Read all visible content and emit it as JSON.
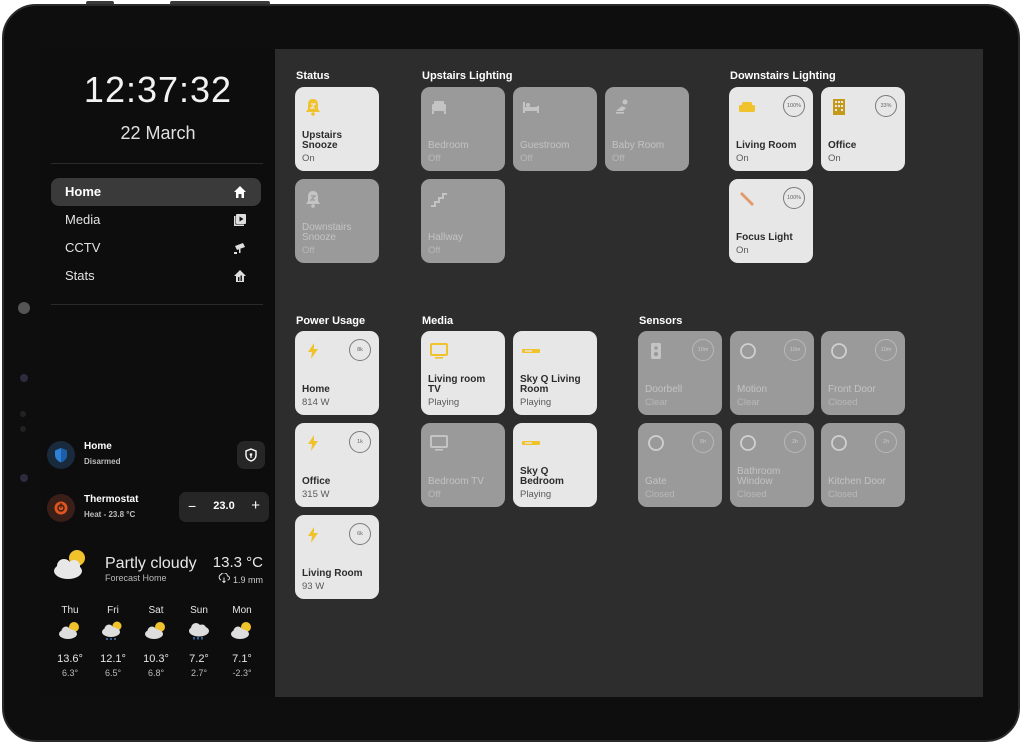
{
  "colors": {
    "accent_yellow": "#f0c22b",
    "tile_on": "#e7e7e7",
    "tile_off": "#9a9a9a",
    "screen_bg": "#2d2d2d",
    "sidebar_bg": "#0d0d0d",
    "alarm_blue": "#1c5fa8",
    "thermo_orange": "#e2541e"
  },
  "sidebar": {
    "time": "12:37:32",
    "date": "22 March",
    "nav": [
      {
        "label": "Home",
        "icon": "home-icon",
        "active": true
      },
      {
        "label": "Media",
        "icon": "media-play-icon"
      },
      {
        "label": "CCTV",
        "icon": "cctv-camera-icon"
      },
      {
        "label": "Stats",
        "icon": "stats-home-icon"
      }
    ],
    "alarm": {
      "title": "Home",
      "status": "Disarmed",
      "icon": "shield-icon"
    },
    "thermostat": {
      "title": "Thermostat",
      "status": "Heat - 23.8 °C",
      "setpoint": "23.0",
      "minus": "−",
      "plus": "+",
      "icon": "thermostat-icon"
    },
    "weather": {
      "condition": "Partly cloudy",
      "source": "Forecast Home",
      "temp": "13.3 °C",
      "precip": "1.9 mm",
      "forecast": [
        {
          "day": "Thu",
          "high": "13.6°",
          "low": "6.3°",
          "icon": "partly-cloudy-icon"
        },
        {
          "day": "Fri",
          "high": "12.1°",
          "low": "6.5°",
          "icon": "rain-icon"
        },
        {
          "day": "Sat",
          "high": "10.3°",
          "low": "6.8°",
          "icon": "partly-cloudy-icon"
        },
        {
          "day": "Sun",
          "high": "7.2°",
          "low": "2.7°",
          "icon": "rain-icon"
        },
        {
          "day": "Mon",
          "high": "7.1°",
          "low": "-2.3°",
          "icon": "partly-cloudy-icon"
        }
      ]
    }
  },
  "sections": {
    "status": {
      "title": "Status",
      "tiles": [
        {
          "name": "Upstairs Snooze",
          "state": "On",
          "on": true,
          "icon": "snooze-bell-icon"
        },
        {
          "name": "Downstairs Snooze",
          "state": "Off",
          "on": false,
          "icon": "snooze-bell-icon"
        }
      ]
    },
    "upstairs": {
      "title": "Upstairs Lighting",
      "tiles": [
        {
          "name": "Bedroom",
          "state": "Off",
          "on": false,
          "icon": "bed-icon"
        },
        {
          "name": "Guestroom",
          "state": "Off",
          "on": false,
          "icon": "bed-icon"
        },
        {
          "name": "Baby Room",
          "state": "Off",
          "on": false,
          "icon": "baby-icon"
        },
        {
          "name": "Hallway",
          "state": "Off",
          "on": false,
          "icon": "stairs-icon"
        }
      ]
    },
    "downstairs": {
      "title": "Downstairs Lighting",
      "tiles": [
        {
          "name": "Living Room",
          "state": "On",
          "on": true,
          "icon": "sofa-icon",
          "ring": "100%"
        },
        {
          "name": "Office",
          "state": "On",
          "on": true,
          "icon": "building-icon",
          "ring": "33%"
        },
        {
          "name": "Focus Light",
          "state": "On",
          "on": true,
          "icon": "light-tube-icon",
          "ring": "100%"
        }
      ]
    },
    "power": {
      "title": "Power Usage",
      "tiles": [
        {
          "name": "Home",
          "state": "814 W",
          "on": true,
          "icon": "bolt-icon",
          "ring": "8k"
        },
        {
          "name": "Office",
          "state": "315 W",
          "on": true,
          "icon": "bolt-icon",
          "ring": "1k"
        },
        {
          "name": "Living Room",
          "state": "93 W",
          "on": true,
          "icon": "bolt-icon",
          "ring": "6k"
        }
      ]
    },
    "media": {
      "title": "Media",
      "tiles": [
        {
          "name": "Living room TV",
          "state": "Playing",
          "on": true,
          "icon": "tv-icon"
        },
        {
          "name": "Sky Q Living Room",
          "state": "Playing",
          "on": true,
          "icon": "set-top-box-icon"
        },
        {
          "name": "Bedroom TV",
          "state": "Off",
          "on": false,
          "icon": "tv-icon"
        },
        {
          "name": "Sky Q Bedroom",
          "state": "Playing",
          "on": true,
          "icon": "set-top-box-icon"
        }
      ]
    },
    "sensors": {
      "title": "Sensors",
      "tiles": [
        {
          "name": "Doorbell",
          "state": "Clear",
          "on": false,
          "icon": "doorbell-icon",
          "ring": "10m"
        },
        {
          "name": "Motion",
          "state": "Clear",
          "on": false,
          "icon": "circle-icon",
          "ring": "10m"
        },
        {
          "name": "Front Door",
          "state": "Closed",
          "on": false,
          "icon": "circle-icon",
          "ring": "10m"
        },
        {
          "name": "Gate",
          "state": "Closed",
          "on": false,
          "icon": "circle-icon",
          "ring": "5h"
        },
        {
          "name": "Bathroom Window",
          "state": "Closed",
          "on": false,
          "icon": "circle-icon",
          "ring": "2h"
        },
        {
          "name": "Kitchen Door",
          "state": "Closed",
          "on": false,
          "icon": "circle-icon",
          "ring": "2h"
        }
      ]
    }
  }
}
